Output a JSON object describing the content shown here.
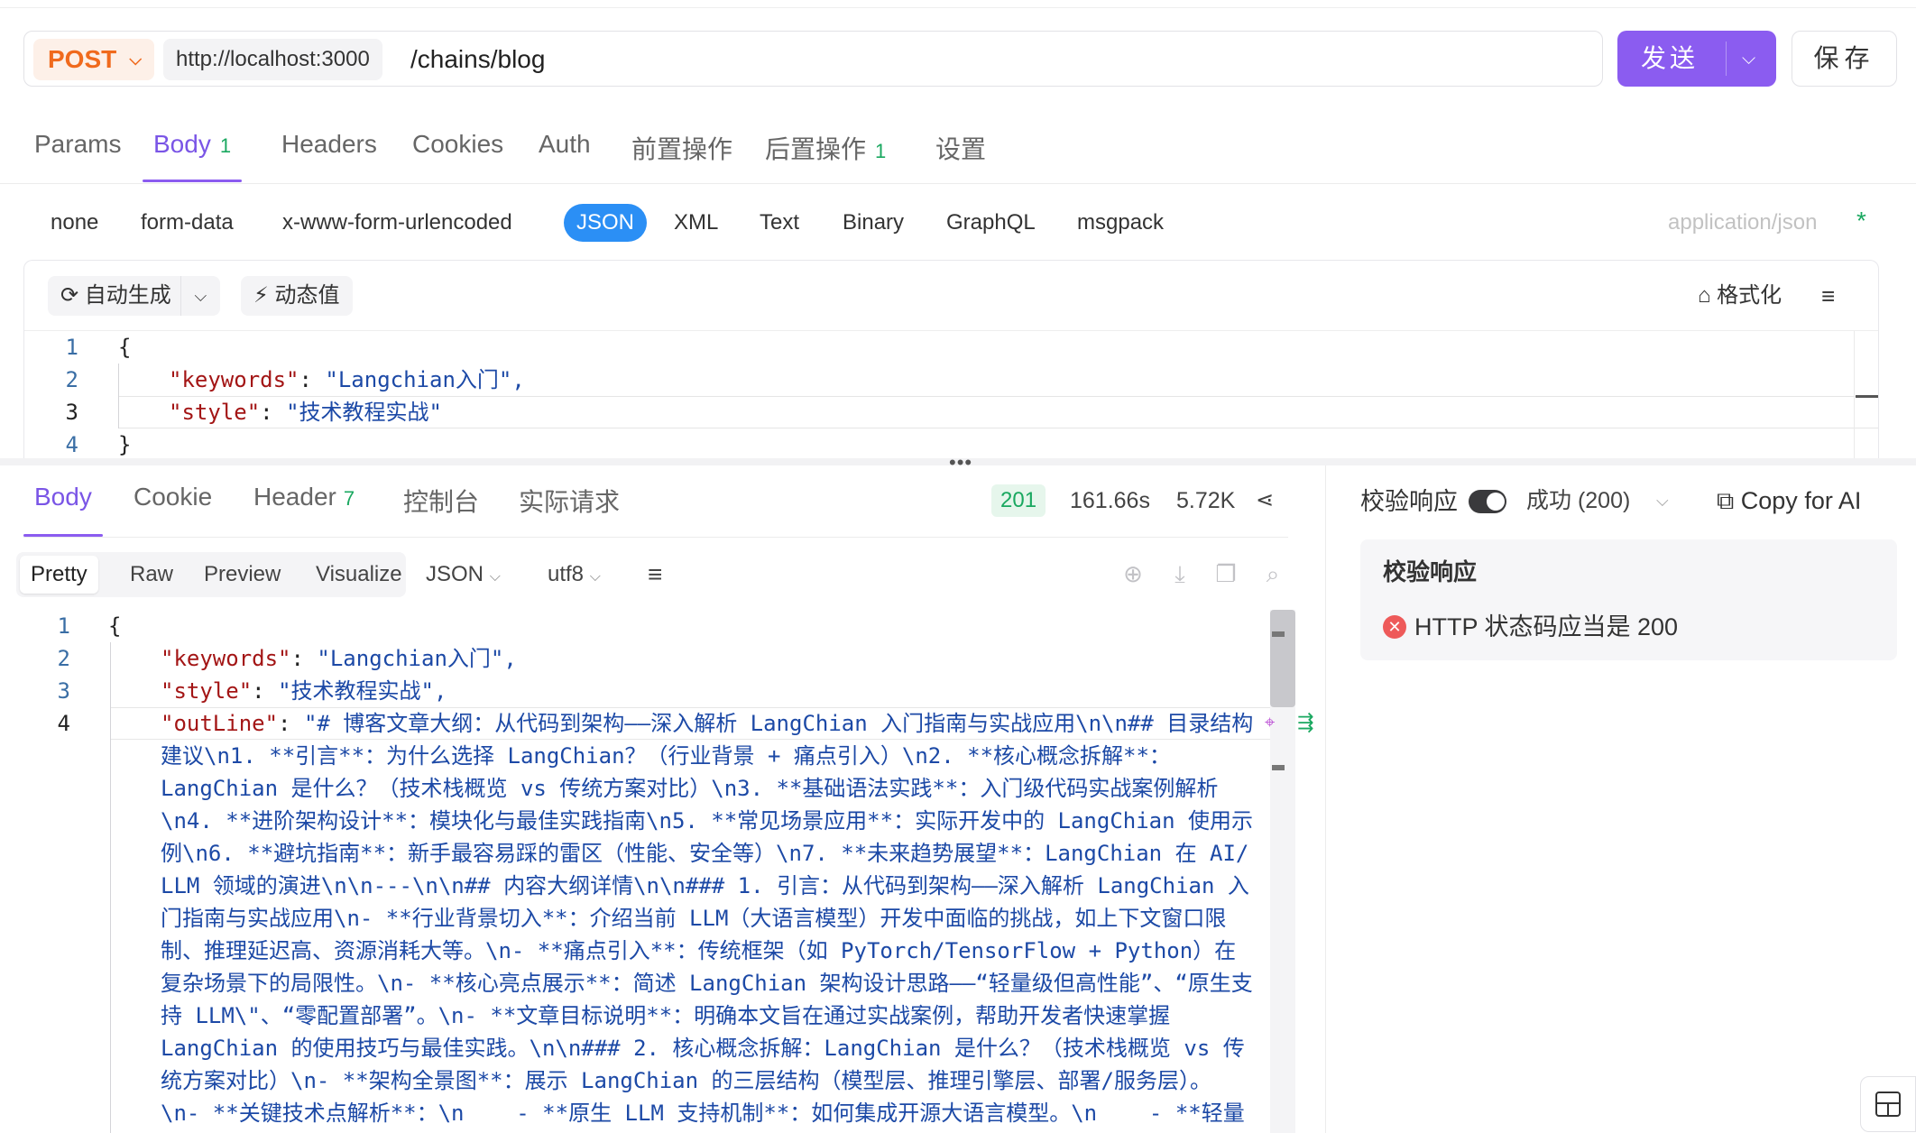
{
  "request": {
    "method": "POST",
    "host": "http://localhost:3000",
    "path": "/chains/blog",
    "send_label": "发送",
    "save_label": "保存"
  },
  "req_tabs": [
    {
      "label": "Params",
      "badge": ""
    },
    {
      "label": "Body",
      "badge": "1"
    },
    {
      "label": "Headers",
      "badge": ""
    },
    {
      "label": "Cookies",
      "badge": ""
    },
    {
      "label": "Auth",
      "badge": ""
    },
    {
      "label": "前置操作",
      "badge": ""
    },
    {
      "label": "后置操作",
      "badge": "1"
    },
    {
      "label": "设置",
      "badge": ""
    }
  ],
  "body_types": [
    "none",
    "form-data",
    "x-www-form-urlencoded",
    "JSON",
    "XML",
    "Text",
    "Binary",
    "GraphQL",
    "msgpack"
  ],
  "content_type": "application/json",
  "required_mark": "*",
  "editor_toolbar": {
    "auto_generate": "自动生成",
    "dynamic_value": "动态值",
    "format": "格式化"
  },
  "request_body_lines": [
    {
      "n": "1",
      "text": "{"
    },
    {
      "n": "2",
      "key": "\"keywords\"",
      "value": "\"Langchian入门\","
    },
    {
      "n": "3",
      "key": "\"style\"",
      "value": "\"技术教程实战\""
    },
    {
      "n": "4",
      "text": "}"
    }
  ],
  "resp_tabs": [
    {
      "label": "Body",
      "badge": ""
    },
    {
      "label": "Cookie",
      "badge": ""
    },
    {
      "label": "Header",
      "badge": "7"
    },
    {
      "label": "控制台",
      "badge": ""
    },
    {
      "label": "实际请求",
      "badge": ""
    }
  ],
  "response_meta": {
    "status": "201",
    "time": "161.66s",
    "size": "5.72K"
  },
  "view_modes": [
    "Pretty",
    "Raw",
    "Preview",
    "Visualize"
  ],
  "view_format": "JSON",
  "view_encoding": "utf8",
  "response_lines": [
    {
      "n": "1",
      "text": "{"
    },
    {
      "n": "2",
      "key": "\"keywords\"",
      "value": "\"Langchian入门\","
    },
    {
      "n": "3",
      "key": "\"style\"",
      "value": "\"技术教程实战\","
    },
    {
      "n": "4",
      "key": "\"outLine\""
    }
  ],
  "outline_first": "\"# 博客文章大纲：从代码到架构——深入解析 LangChian 入门指南与实战应用\\n\\n## 目录结构",
  "outline_wrapped": [
    "建议\\n1. **引言**：为什么选择 LangChian？（行业背景 + 痛点引入）\\n2. **核心概念拆解**：",
    "LangChian 是什么？（技术栈概览 vs 传统方案对比）\\n3. **基础语法实践**：入门级代码实战案例解析",
    "\\n4. **进阶架构设计**：模块化与最佳实践指南\\n5. **常见场景应用**：实际开发中的 LangChian 使用示",
    "例\\n6. **避坑指南**：新手最容易踩的雷区（性能、安全等）\\n7. **未来趋势展望**：LangChian 在 AI/",
    "LLM 领域的演进\\n\\n---\\n\\n## 内容大纲详情\\n\\n### 1. 引言：从代码到架构——深入解析 LangChian 入",
    "门指南与实战应用\\n- **行业背景切入**：介绍当前 LLM（大语言模型）开发中面临的挑战，如上下文窗口限",
    "制、推理延迟高、资源消耗大等。\\n- **痛点引入**：传统框架（如 PyTorch/TensorFlow + Python）在",
    "复杂场景下的局限性。\\n- **核心亮点展示**：简述 LangChian 架构设计思路——“轻量级但高性能”、“原生支",
    "持 LLM\\\"、“零配置部署”。\\n- **文章目标说明**：明确本文旨在通过实战案例，帮助开发者快速掌握",
    "LangChian 的使用技巧与最佳实践。\\n\\n### 2. 核心概念拆解：LangChian 是什么？（技术栈概览 vs 传",
    "统方案对比）\\n- **架构全景图**：展示 LangChian 的三层结构（模型层、推理引擎层、部署/服务层）。",
    "\\n- **关键技术点解析**：\\n    - **原生 LLM 支持机制**：如何集成开源大语言模型。\\n    - **轻量"
  ],
  "validation": {
    "toggle_label": "校验响应",
    "result_select": "成功 (200)",
    "copy_ai": "Copy for AI",
    "box_title": "校验响应",
    "error_text": "HTTP 状态码应当是 200"
  }
}
